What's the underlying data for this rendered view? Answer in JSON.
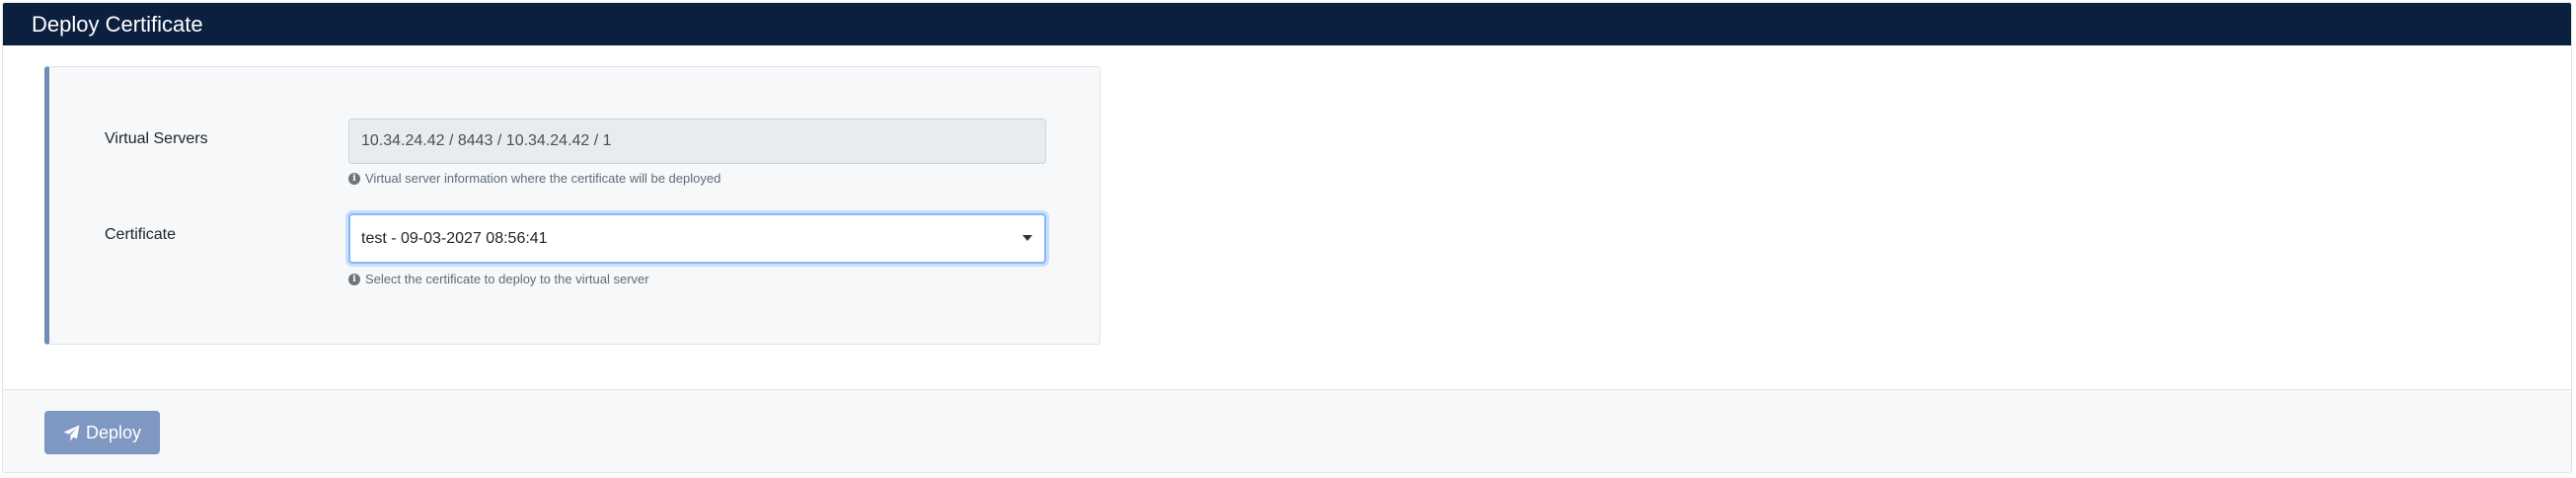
{
  "header": {
    "title": "Deploy Certificate",
    "background_color": "#0b1f3f"
  },
  "form": {
    "virtual_servers": {
      "label": "Virtual Servers",
      "value": "10.34.24.42 / 8443 / 10.34.24.42 / 1",
      "help": "Virtual server information where the certificate will be deployed",
      "help_icon": "info-icon"
    },
    "certificate": {
      "label": "Certificate",
      "selected": "test - 09-03-2027 08:56:41",
      "help": "Select the certificate to deploy to the virtual server",
      "help_icon": "info-icon",
      "caret_icon": "caret-down-icon"
    }
  },
  "footer": {
    "deploy_label": "Deploy",
    "deploy_icon": "paper-plane-icon",
    "deploy_color": "#7f98c2"
  }
}
